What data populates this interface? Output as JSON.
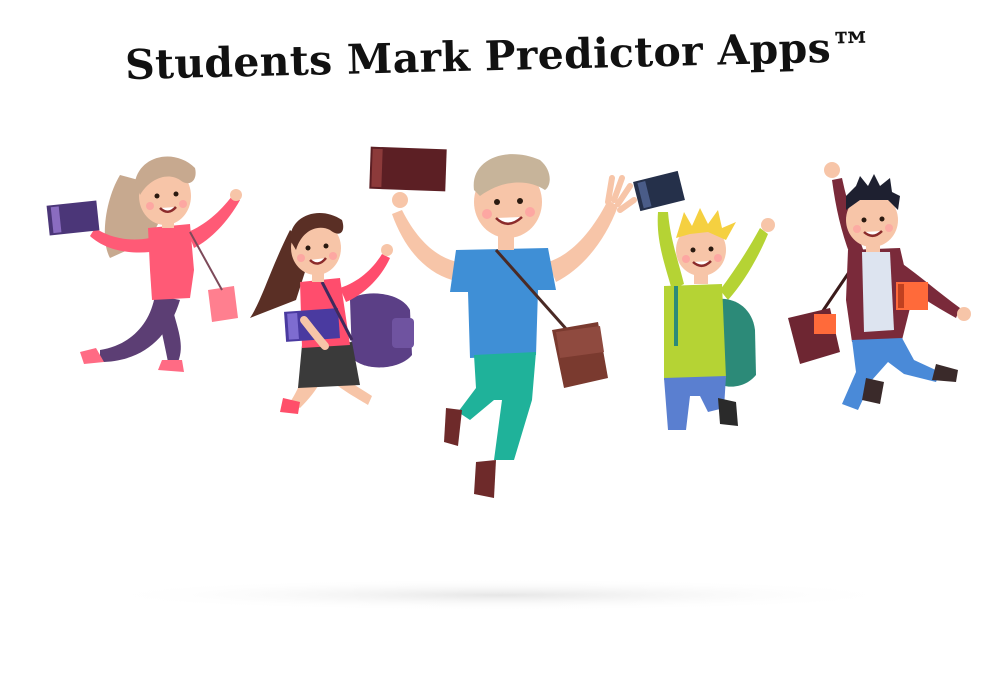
{
  "title": "Students Mark Predictor Apps™",
  "colors": {
    "background": "#ffffff",
    "title_text": "#111111",
    "ground_shadow": "#eeeeee"
  },
  "illustration": {
    "name": "five-jumping-students",
    "figures": [
      {
        "id": "girl-blonde-pink",
        "holds": "book"
      },
      {
        "id": "girl-brunette-backpack",
        "holds": "book"
      },
      {
        "id": "boy-blue-shirt-bag",
        "holds": "book"
      },
      {
        "id": "boy-yellow-hair-backpack",
        "holds": "book"
      },
      {
        "id": "boy-dark-hair-jacket",
        "holds": "book"
      }
    ]
  }
}
